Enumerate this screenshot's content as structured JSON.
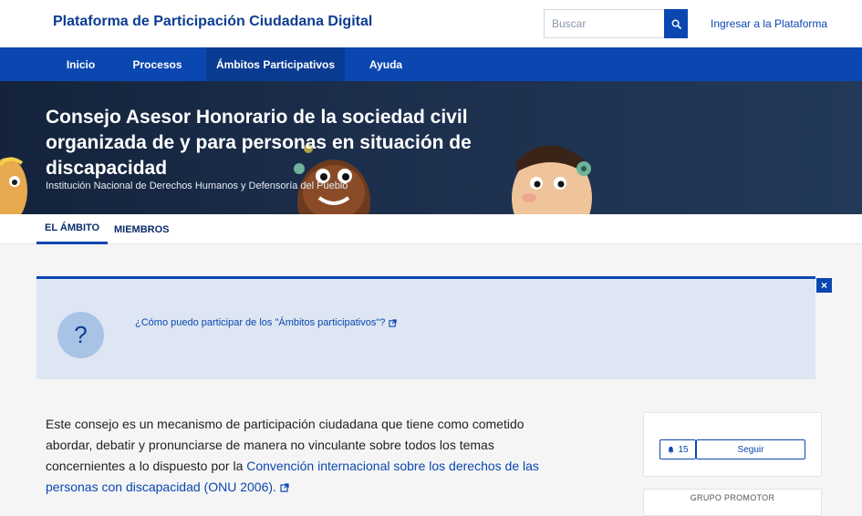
{
  "header": {
    "site_title": "Plataforma de Participación Ciudadana Digital",
    "search_placeholder": "Buscar",
    "login_label": "Ingresar a la Plataforma"
  },
  "nav": {
    "items": [
      {
        "label": "Inicio"
      },
      {
        "label": "Procesos"
      },
      {
        "label": "Ámbitos Participativos",
        "active": true
      },
      {
        "label": "Ayuda"
      }
    ]
  },
  "hero": {
    "title": "Consejo Asesor Honorario de la sociedad civil organizada de y para personas en situación de discapacidad",
    "subtitle": "Institución Nacional de Derechos Humanos y Defensoría del Pueblo"
  },
  "tabs": [
    {
      "label": "EL ÁMBITO",
      "active": true
    },
    {
      "label": "MIEMBROS"
    }
  ],
  "info_box": {
    "icon_text": "?",
    "link_text": "¿Cómo puedo participar de los \"Ámbitos participativos\"?",
    "close_symbol": "×"
  },
  "description": {
    "text": "Este consejo es un mecanismo de participación ciudadana que tiene como cometido abordar, debatir y pronunciarse de manera no vinculante sobre todos los temas concernientes a lo dispuesto por la ",
    "link_text": "Convención internacional sobre los derechos de las personas con discapacidad (ONU 2006)."
  },
  "sidebar": {
    "followers_count": "15",
    "follow_label": "Seguir",
    "promoter_title": "GRUPO PROMOTOR"
  },
  "colors": {
    "primary": "#0b47b0",
    "brand_text": "#0b3d91",
    "hero_bg": "#1c2f4d",
    "info_bg": "#dde6f2"
  }
}
